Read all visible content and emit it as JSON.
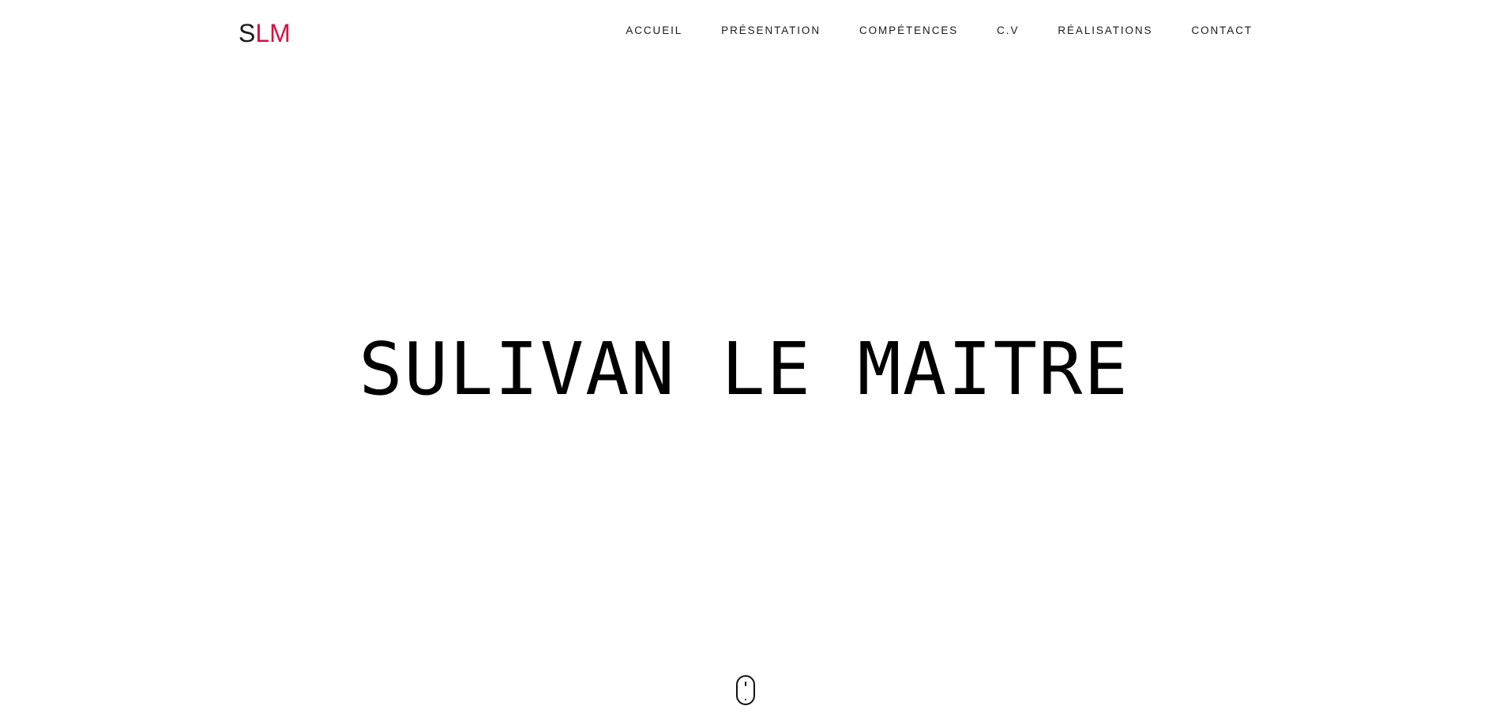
{
  "header": {
    "logo": {
      "first_letter": "S",
      "rest": "LM",
      "first_color": "#1a1a1a",
      "accent_color": "#d6123f"
    },
    "nav": [
      {
        "label": "ACCUEIL"
      },
      {
        "label": "PRÉSENTATION"
      },
      {
        "label": "COMPÉTENCES"
      },
      {
        "label": "C.V"
      },
      {
        "label": "RÉALISATIONS"
      },
      {
        "label": "CONTACT"
      }
    ]
  },
  "hero": {
    "title": "SULIVAN LE MAITRE"
  },
  "scroll_indicator": {
    "icon": "mouse-scroll-icon"
  }
}
